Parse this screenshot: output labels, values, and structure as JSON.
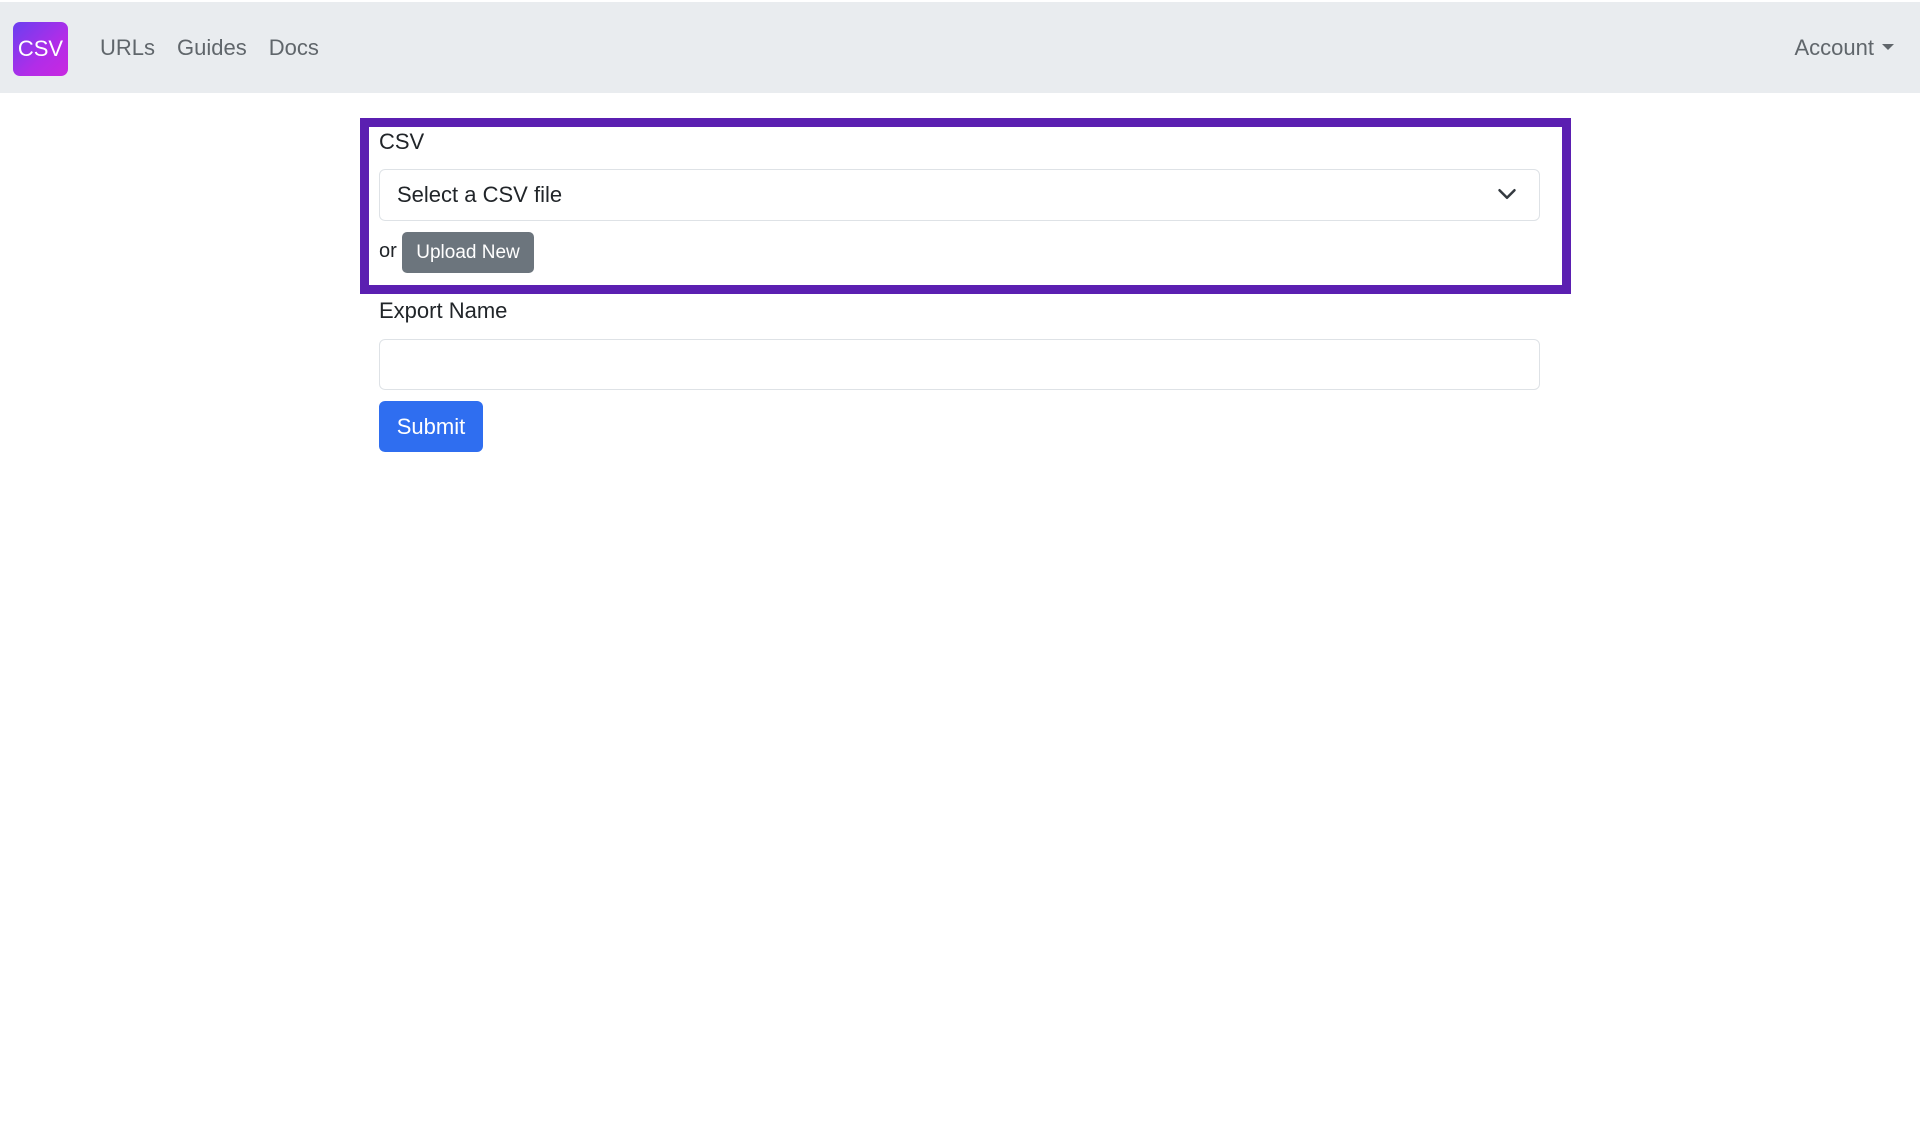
{
  "navbar": {
    "logo_text": "CSV",
    "links": [
      {
        "label": "URLs"
      },
      {
        "label": "Guides"
      },
      {
        "label": "Docs"
      }
    ],
    "account_label": "Account"
  },
  "form": {
    "csv_label": "CSV",
    "csv_select_value": "Select a CSV file",
    "or_text": "or",
    "upload_button_label": "Upload New",
    "export_name_label": "Export Name",
    "export_name_value": "",
    "submit_label": "Submit"
  },
  "colors": {
    "highlight_border": "#5b1fb1",
    "primary": "#2f6ef0",
    "secondary": "#6c757d",
    "navbar_bg": "#e9ecef"
  },
  "icons": {
    "select_chevron": "chevron-down-icon",
    "account_caret": "caret-down-icon"
  }
}
